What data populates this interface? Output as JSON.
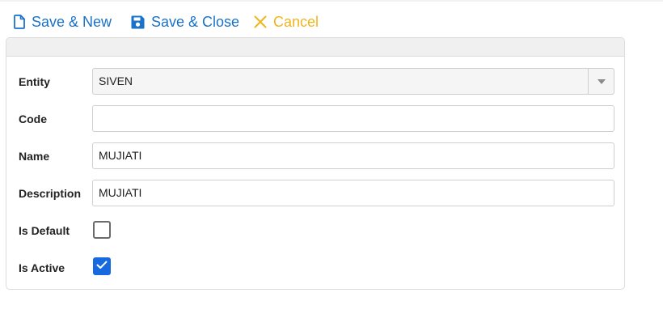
{
  "toolbar": {
    "save_new_label": "Save & New",
    "save_close_label": "Save & Close",
    "cancel_label": "Cancel"
  },
  "form": {
    "entity": {
      "label": "Entity",
      "value": "SIVEN"
    },
    "code": {
      "label": "Code",
      "value": ""
    },
    "name": {
      "label": "Name",
      "value": "MUJIATI"
    },
    "description": {
      "label": "Description",
      "value": "MUJIATI"
    },
    "is_default": {
      "label": "Is Default",
      "checked": false
    },
    "is_active": {
      "label": "Is Active",
      "checked": true
    }
  },
  "colors": {
    "primary": "#1a73c9",
    "cancel": "#f0b51c",
    "checkbox_active": "#1769e0"
  },
  "icons": {
    "save_new": "file-icon",
    "save_close": "floppy-disk-icon",
    "cancel": "close-icon",
    "select_arrow": "chevron-down-icon",
    "check": "checkmark-icon"
  }
}
